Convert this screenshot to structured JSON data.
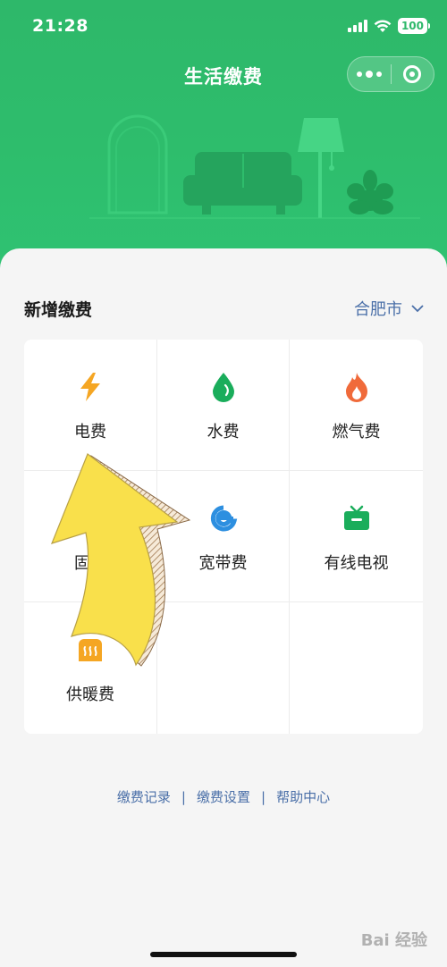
{
  "status_bar": {
    "time": "21:28",
    "battery": "100"
  },
  "nav": {
    "title": "生活缴费"
  },
  "section": {
    "title": "新增缴费",
    "city": "合肥市"
  },
  "items": [
    {
      "label": "电费",
      "icon": "lightning-icon",
      "color": "#f5a623"
    },
    {
      "label": "水费",
      "icon": "water-drop-icon",
      "color": "#1aad5b"
    },
    {
      "label": "燃气费",
      "icon": "flame-icon",
      "color": "#f06a3a"
    },
    {
      "label": "固话",
      "icon": "phone-icon",
      "color": "#f5a623"
    },
    {
      "label": "宽带费",
      "icon": "broadband-e-icon",
      "color": "#2d8fe0"
    },
    {
      "label": "有线电视",
      "icon": "tv-icon",
      "color": "#1aad5b"
    },
    {
      "label": "供暖费",
      "icon": "heating-icon",
      "color": "#f5a623"
    }
  ],
  "footer": {
    "links": [
      "缴费记录",
      "缴费设置",
      "帮助中心"
    ],
    "separator": "|"
  },
  "watermark": "Bai 经验",
  "colors": {
    "header_green": "#2eb86a",
    "link_blue": "#4a6fa8",
    "arrow_yellow": "#f9e04b"
  }
}
